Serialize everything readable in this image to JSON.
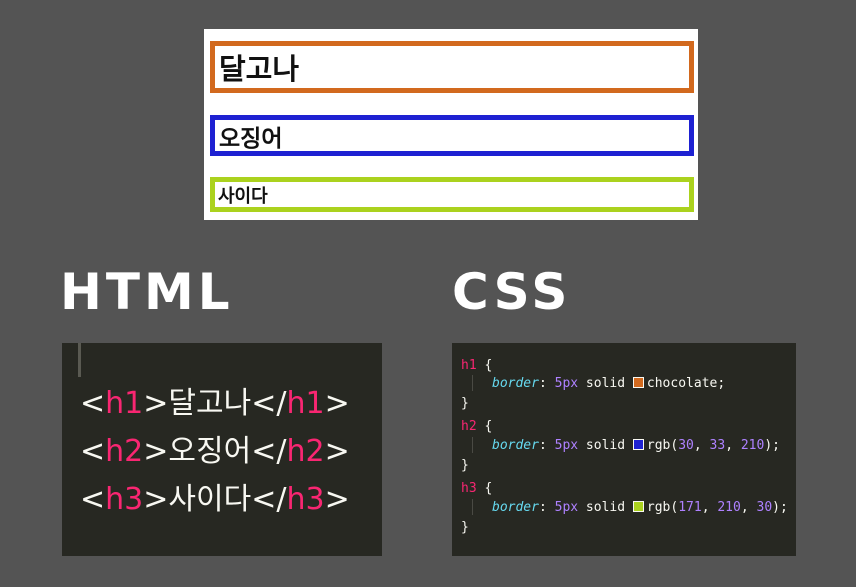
{
  "preview": {
    "h1_text": "달고나",
    "h2_text": "오징어",
    "h3_text": "사이다"
  },
  "labels": {
    "html": "HTML",
    "css": "CSS"
  },
  "html_code": [
    {
      "open": "h1",
      "text": "달고나",
      "close": "h1"
    },
    {
      "open": "h2",
      "text": "오징어",
      "close": "h2"
    },
    {
      "open": "h3",
      "text": "사이다",
      "close": "h3"
    }
  ],
  "css_code": {
    "rules": [
      {
        "selector": "h1",
        "property": "border",
        "value_prefix": "5px solid",
        "color_name": "chocolate",
        "swatch": "#d2691e",
        "rgb": null
      },
      {
        "selector": "h2",
        "property": "border",
        "value_prefix": "5px solid",
        "color_name": "rgb",
        "swatch": "#1e21d2",
        "rgb": [
          "30",
          "33",
          "210"
        ]
      },
      {
        "selector": "h3",
        "property": "border",
        "value_prefix": "5px solid",
        "color_name": "rgb",
        "swatch": "#abd21e",
        "rgb": [
          "171",
          "210",
          "30"
        ]
      }
    ]
  },
  "colors": {
    "background": "#545454",
    "editor_bg": "#272822",
    "tag": "#f92672",
    "property": "#66d9ef",
    "number": "#ae81ff"
  }
}
